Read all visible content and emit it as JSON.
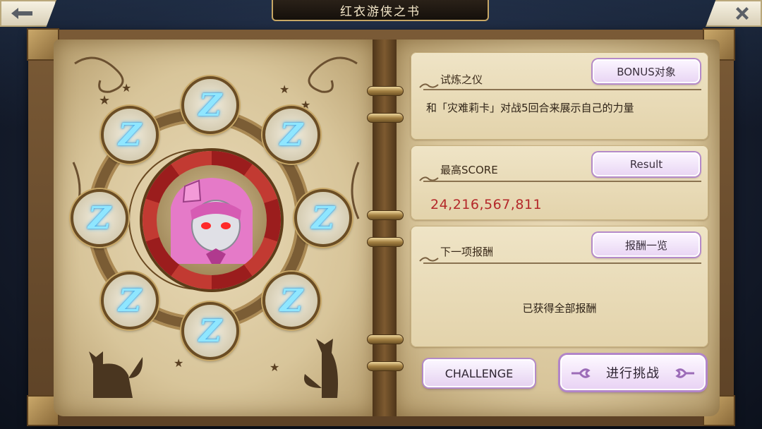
{
  "header": {
    "title": "红衣游侠之书",
    "back_icon": "back-arrow-icon",
    "close_icon": "close-icon"
  },
  "left_page": {
    "portrait_alt": "pink armored character portrait",
    "emblems": [
      "Z",
      "Z",
      "Z",
      "Z",
      "Z",
      "Z",
      "Z",
      "Z"
    ]
  },
  "panels": {
    "trial": {
      "label": "试炼之仪",
      "button": "BONUS对象",
      "description": "和「灾难莉卡」对战5回合来展示自己的力量"
    },
    "score": {
      "label": "最高SCORE",
      "button": "Result",
      "value": "24,216,567,811"
    },
    "reward": {
      "label": "下一项报酬",
      "button": "报酬一览",
      "status": "已获得全部报酬"
    }
  },
  "actions": {
    "challenge_label": "CHALLENGE",
    "start_label": "进行挑战"
  },
  "colors": {
    "score_red": "#b4282a",
    "emblem_glow": "#8fe6ff",
    "button_border": "#b58ac9"
  }
}
